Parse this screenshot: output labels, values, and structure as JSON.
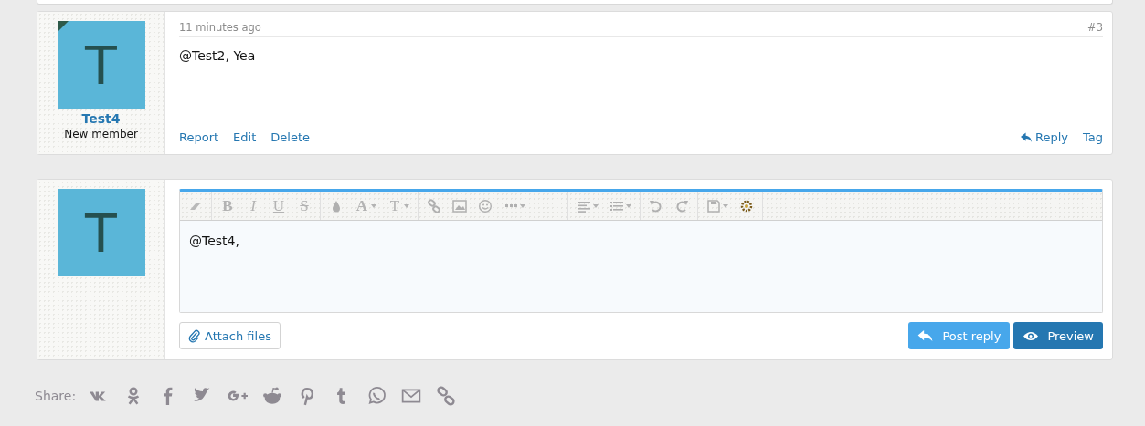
{
  "post": {
    "avatar_letter": "T",
    "username": "Test4",
    "user_title": "New member",
    "time": "11 minutes ago",
    "number": "#3",
    "message": "@Test2, Yea",
    "actions_left": [
      "Report",
      "Edit",
      "Delete"
    ],
    "actions_right": [
      {
        "label": "Reply",
        "kind": "reply"
      },
      {
        "label": "Tag",
        "kind": "plain"
      }
    ]
  },
  "reply": {
    "avatar_letter": "T",
    "toolbar": [
      [
        {
          "kind": "eraser"
        }
      ],
      [
        {
          "kind": "bold",
          "label": "B"
        },
        {
          "kind": "italic",
          "label": "I"
        },
        {
          "kind": "underline",
          "label": "U"
        },
        {
          "kind": "strike",
          "label": "S"
        }
      ],
      [
        {
          "kind": "color"
        },
        {
          "kind": "font",
          "label": "A",
          "dropdown": true
        },
        {
          "kind": "size",
          "label": "T",
          "dropdown": true
        }
      ],
      [
        {
          "kind": "link"
        },
        {
          "kind": "image"
        },
        {
          "kind": "smilie"
        },
        {
          "kind": "more",
          "dropdown": true
        }
      ],
      [
        {
          "kind": "align",
          "dropdown": true
        },
        {
          "kind": "list",
          "dropdown": true
        }
      ],
      [
        {
          "kind": "undo"
        },
        {
          "kind": "redo"
        }
      ],
      [
        {
          "kind": "drafts",
          "dropdown": true
        },
        {
          "kind": "gear"
        }
      ]
    ],
    "editor_text": "@Test4,",
    "attach": "Attach files",
    "post_button": "Post reply",
    "preview_button": "Preview"
  },
  "share": {
    "label": "Share:",
    "icons": [
      {
        "kind": "vk"
      },
      {
        "kind": "odnoklassniki"
      },
      {
        "kind": "facebook"
      },
      {
        "kind": "twitter"
      },
      {
        "kind": "google-plus"
      },
      {
        "kind": "reddit"
      },
      {
        "kind": "pinterest"
      },
      {
        "kind": "tumblr"
      },
      {
        "kind": "whatsapp"
      },
      {
        "kind": "email"
      },
      {
        "kind": "link"
      }
    ]
  }
}
